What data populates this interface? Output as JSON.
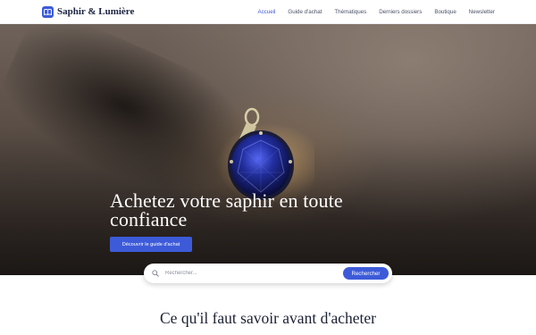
{
  "brand": {
    "name": "Saphir & Lumière",
    "logo_icon": "open-book-icon",
    "accent_color": "#3d5bd9"
  },
  "nav": {
    "items": [
      {
        "label": "Accueil",
        "active": true
      },
      {
        "label": "Guide d'achat",
        "active": false
      },
      {
        "label": "Thématiques",
        "active": false
      },
      {
        "label": "Derniers dossiers",
        "active": false
      },
      {
        "label": "Boutique",
        "active": false
      },
      {
        "label": "Newsletter",
        "active": false
      }
    ]
  },
  "hero": {
    "title": "Achetez votre saphir en toute confiance",
    "cta_label": "Découvrir le guide d'achat"
  },
  "search": {
    "placeholder": "Rechercher...",
    "button_label": "Rechercher",
    "icon": "search-icon"
  },
  "section": {
    "title": "Ce qu'il faut savoir avant d'acheter"
  }
}
